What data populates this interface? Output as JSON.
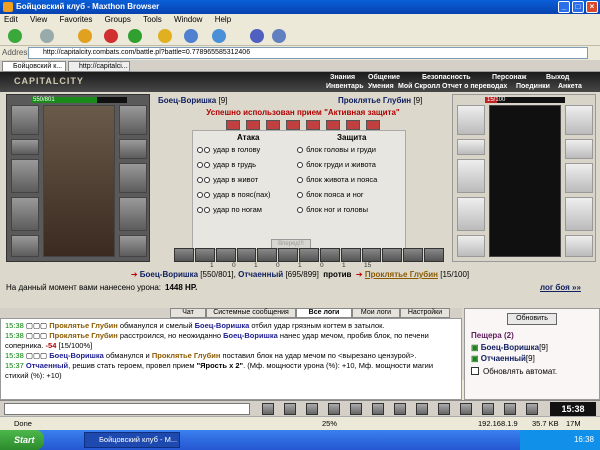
{
  "window": {
    "title": "Бойцовский клуб - Maxthon Browser"
  },
  "menu": [
    "Edit",
    "View",
    "Favorites",
    "Groups",
    "Tools",
    "Window",
    "Help"
  ],
  "address": {
    "label": "Address",
    "url": "http://capitalcity.combats.com/battle.pl?battle=0.778965585312406"
  },
  "browser_tabs": [
    "Бойцовский к...",
    "http://capitalci..."
  ],
  "game": {
    "logo": "CAPITALCITY",
    "nav_top": [
      "Знания",
      "Общение",
      "Безопасность",
      "Персонаж",
      "Выход"
    ],
    "nav_bottom": [
      "Инвентарь",
      "Умения",
      "Мой Скролл",
      "Отчет о переводах",
      "Поединки",
      "Анкета"
    ],
    "player": {
      "name": "Боец-Воришка",
      "level": "[9]",
      "hp": "550/801",
      "hp_fraction": 0.687
    },
    "enemy": {
      "name": "Проклятье Глубин",
      "level": "[9]",
      "hp": "15/100",
      "hp_fraction": 0.15
    },
    "success_msg": "Успешно использован прием \"Активная защита\"",
    "attack_header": "Атака",
    "defense_header": "Защита",
    "attacks": [
      "удар в голову",
      "удар в грудь",
      "удар в живот",
      "удар в пояс(пах)",
      "удар по ногам"
    ],
    "defenses": [
      "блок головы и груди",
      "блок груди и живота",
      "блок живота и пояса",
      "блок пояса и ног",
      "блок ног и головы"
    ],
    "strike_button": "Вперед!!!",
    "stats": [
      "1",
      "0",
      "1",
      "0",
      "1",
      "0",
      "1",
      "15"
    ],
    "vs_line": {
      "p1": "Боец-Воришка",
      "p1_hp": "[550/801]",
      "p2": "Отчаенный",
      "p2_hp": "[695/899]",
      "vs": "против",
      "p3": "Проклятье Глубин",
      "p3_hp": "[15/100]"
    },
    "damage_label": "На данный момент вами нанесено урона:",
    "damage_value": "1448 HP.",
    "log_more": "лог боя »»"
  },
  "chat": {
    "tabs": [
      "Чат",
      "Системные сообщения",
      "Все логи",
      "Мои логи",
      "Настройки"
    ],
    "active_tab": "Все логи",
    "lines": [
      {
        "time": "15:38",
        "a": "Проклятье Глубин",
        "t1": " обманулся и смелый ",
        "b": "Боец-Воришка",
        "t2": " отбил удар грязным когтем в затылок."
      },
      {
        "time": "15:38",
        "a": "Проклятье Глубин",
        "t1": " расстроился, но неожиданно ",
        "b": "Боец-Воришка",
        "t2": " нанес удар мечом, пробив блок, по печени соперника. ",
        "dmg": "-54",
        "hp": " [15/100%]"
      },
      {
        "time": "15:38",
        "a": "Боец-Воришка",
        "t1": " обманулся и ",
        "b": "Проклятье Глубин",
        "t2": " поставил блок на удар мечом по <вырезано цензурой>."
      },
      {
        "time": "15:37",
        "a": "Отчаенный",
        "t1": ", решив стать героем, провел прием ",
        "b": "\"Ярость x 2\"",
        "t2": ". (Мф. мощности урона (%): +10, Мф. мощности магии стихий (%): +10)"
      }
    ]
  },
  "sidebar": {
    "refresh_button": "Обновить",
    "room": "Пещера (2)",
    "members": [
      {
        "name": "Боец-Воришка",
        "level": "[9]"
      },
      {
        "name": "Отчаенный",
        "level": "[9]"
      }
    ],
    "auto_refresh": "Обновлять автомат."
  },
  "clock": "15:38",
  "statusbar": {
    "left": "Done",
    "zoom": "25%",
    "ip": "192.168.1.9",
    "speed": "35.7 KB",
    "mem": "17M"
  },
  "taskbar": {
    "start": "Start",
    "task": "Бойцовский клуб - M...",
    "time": "16:38"
  }
}
